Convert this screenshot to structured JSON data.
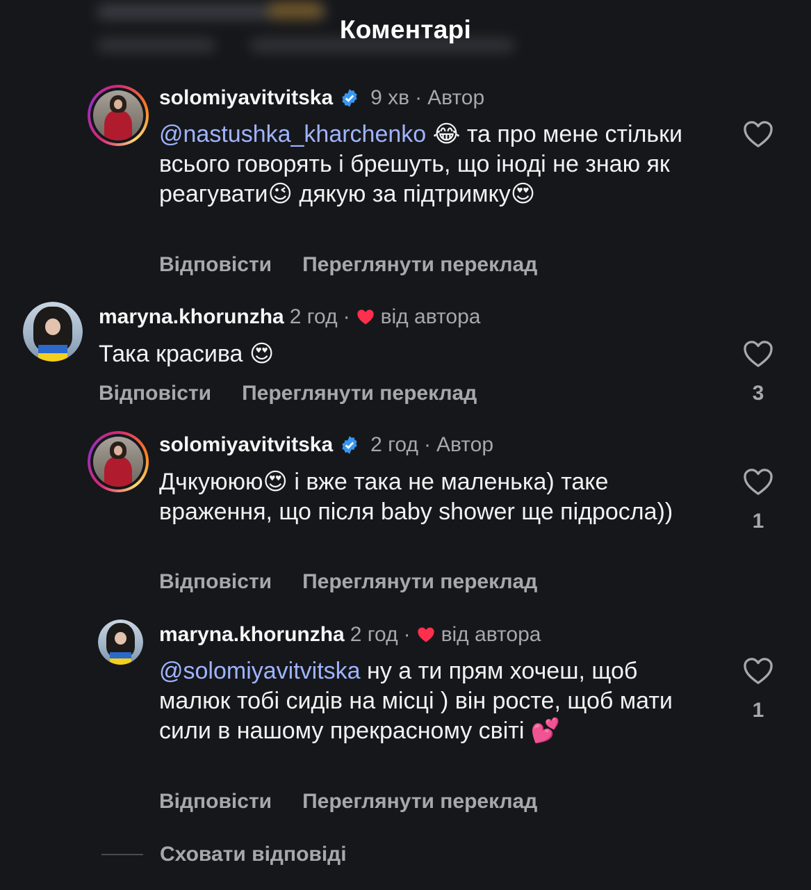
{
  "header": {
    "title": "Коментарі"
  },
  "colors": {
    "background": "#16171b",
    "mention": "#9fb4ff",
    "secondary": "#a8a8ab",
    "heart": "#ff2f4d",
    "verified": "#3897f0"
  },
  "comments": [
    {
      "username": "solomiyavitvitska",
      "verified": true,
      "time": "9 хв",
      "sep": "·",
      "badge": "Автор",
      "mention": "@nastushka_kharchenko",
      "text": " 😂 та про мене стільки всього говорять і брешуть, що іноді не знаю як реагувати😉 дякую за підтримку😍",
      "reply_label": "Відповісти",
      "translate_label": "Переглянути переклад",
      "likes": ""
    },
    {
      "username": "maryna.khorunzha",
      "verified": false,
      "time": "2 год",
      "sep": "·",
      "badge": "від автора",
      "mention": "",
      "text": "Така красива 😍",
      "reply_label": "Відповісти",
      "translate_label": "Переглянути переклад",
      "likes": "3"
    },
    {
      "username": "solomiyavitvitska",
      "verified": true,
      "time": "2 год",
      "sep": "·",
      "badge": "Автор",
      "mention": "",
      "text": "Дчкуююю😍 і вже така не маленька) таке враження, що після baby shower ще підросла))",
      "reply_label": "Відповісти",
      "translate_label": "Переглянути переклад",
      "likes": "1"
    },
    {
      "username": "maryna.khorunzha",
      "verified": false,
      "time": "2 год",
      "sep": "·",
      "badge": "від автора",
      "mention": "@solomiyavitvitska",
      "text": " ну а ти прям хочеш, щоб малюк тобі сидів на місці ) він росте, щоб мати сили в нашому прекрасному світі 💕",
      "reply_label": "Відповісти",
      "translate_label": "Переглянути переклад",
      "likes": "1"
    }
  ],
  "hide_replies": "Сховати відповіді"
}
